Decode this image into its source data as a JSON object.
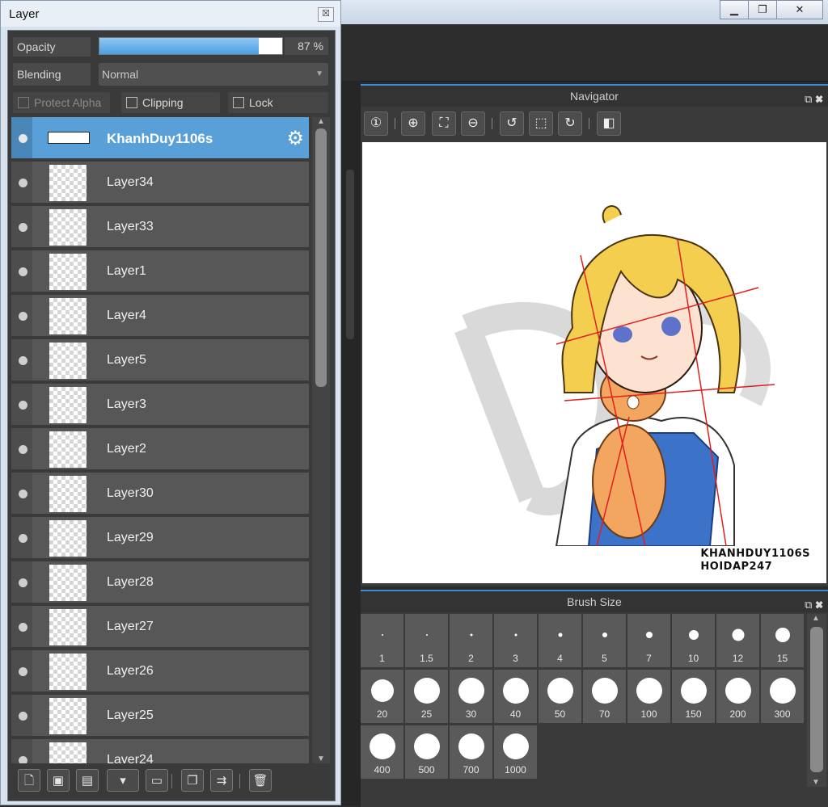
{
  "window": {
    "minimize_glyph": "▁",
    "maximize_glyph": "❐",
    "close_glyph": "✕"
  },
  "layer_panel": {
    "title": "Layer",
    "close_glyph": "☒",
    "opacity_label": "Opacity",
    "opacity_value": "87 %",
    "opacity_fraction": 0.87,
    "blending_label": "Blending",
    "blending_value": "Normal",
    "protect_alpha_label": "Protect Alpha",
    "clipping_label": "Clipping",
    "lock_label": "Lock",
    "layers": [
      {
        "name": "KhanhDuy1106s",
        "selected": true
      },
      {
        "name": "Layer34"
      },
      {
        "name": "Layer33"
      },
      {
        "name": "Layer1"
      },
      {
        "name": "Layer4"
      },
      {
        "name": "Layer5"
      },
      {
        "name": "Layer3"
      },
      {
        "name": "Layer2"
      },
      {
        "name": "Layer30"
      },
      {
        "name": "Layer29"
      },
      {
        "name": "Layer28"
      },
      {
        "name": "Layer27"
      },
      {
        "name": "Layer26"
      },
      {
        "name": "Layer25"
      },
      {
        "name": "Layer24"
      }
    ],
    "toolbar_icons": [
      "new-layer-icon",
      "new-halftone-layer-icon",
      "new-1bit-layer-icon",
      "add-layer-menu-icon",
      "folder-icon",
      "duplicate-layer-icon",
      "merge-layer-icon",
      "delete-layer-icon"
    ]
  },
  "navigator": {
    "title": "Navigator",
    "tool_icons": [
      "zoom-actual-icon",
      "zoom-in-icon",
      "fit-icon",
      "zoom-out-icon",
      "rotate-left-icon",
      "fit-window-icon",
      "rotate-right-icon",
      "flip-icon"
    ],
    "caption_line1": "KHANHDUY1106S",
    "caption_line2": "HOIDAP247"
  },
  "brush_size": {
    "title": "Brush Size",
    "sizes": [
      "1",
      "1.5",
      "2",
      "3",
      "4",
      "5",
      "7",
      "10",
      "12",
      "15",
      "20",
      "25",
      "30",
      "40",
      "50",
      "70",
      "100",
      "150",
      "200",
      "300",
      "400",
      "500",
      "700",
      "1000"
    ]
  }
}
